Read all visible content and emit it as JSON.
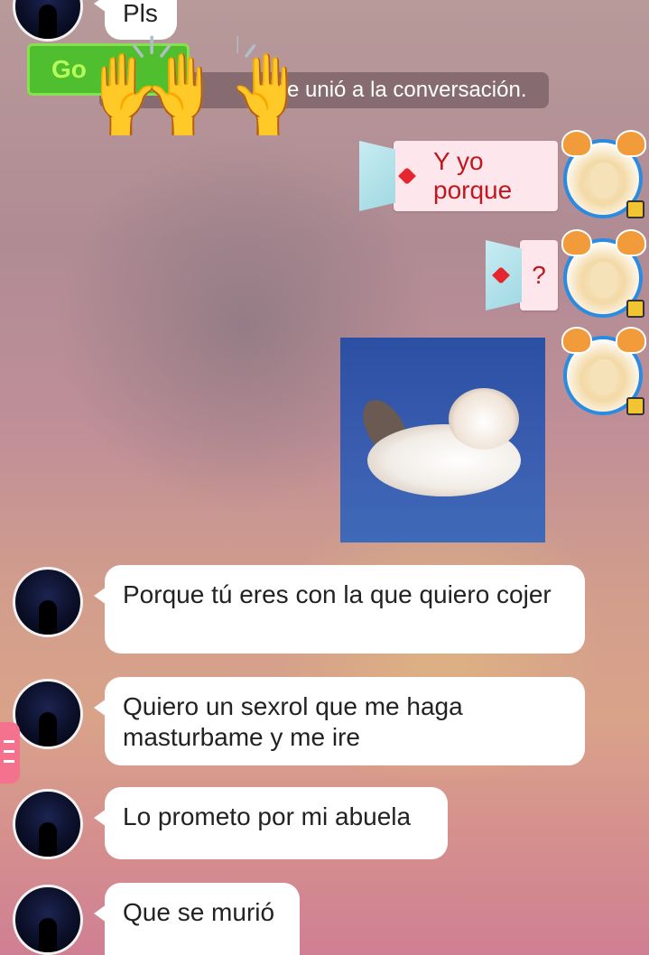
{
  "messages": {
    "top_partial": "Pls",
    "system": "se unió a la conversación.",
    "go_label": "Go",
    "out1": "Y yo porque",
    "out2": "?",
    "in1": "Porque tú eres con la que quiero cojer",
    "in2": "Quiero un sexrol que me haga masturbame y me ire",
    "in3": "Lo prometo por mi abuela",
    "in4": "Que se murió"
  },
  "icons": {
    "hands": "🙌",
    "side_menu": "menu-icon"
  },
  "colors": {
    "outgoing_text": "#c0181e",
    "go_button": "#4fbf2f",
    "side_tab": "#f5728f"
  }
}
